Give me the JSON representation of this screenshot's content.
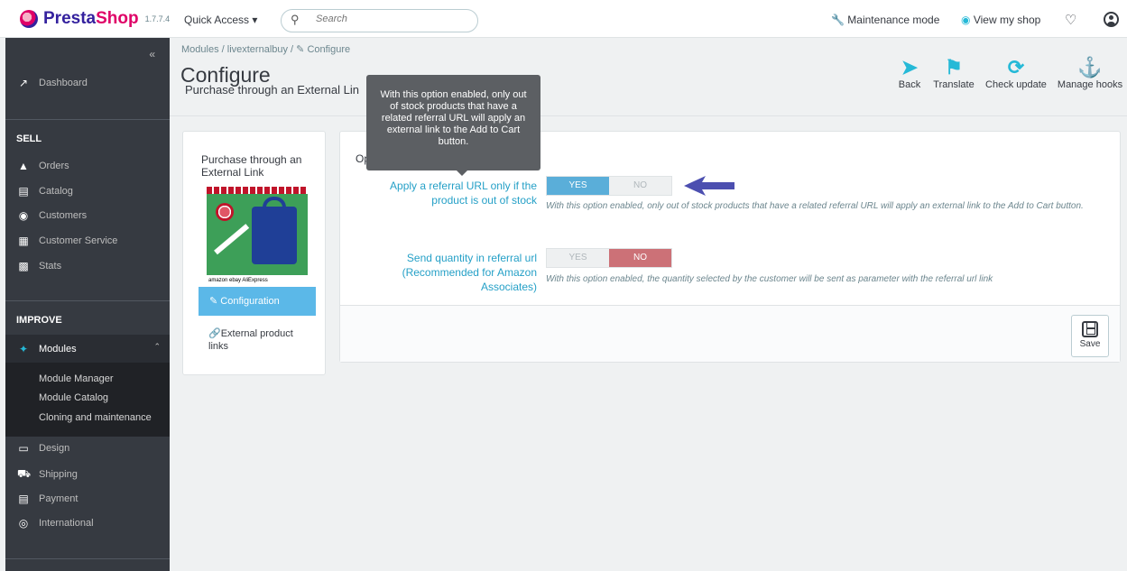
{
  "header": {
    "brand_name_a": "Presta",
    "brand_name_b": "Shop",
    "version": "1.7.7.4",
    "quick_access": "Quick Access ▾",
    "search_placeholder": "Search",
    "maintenance": "Maintenance mode",
    "view_shop": "View my shop"
  },
  "sidebar": {
    "dashboard": "Dashboard",
    "sell_title": "SELL",
    "sell_items": [
      "Orders",
      "Catalog",
      "Customers",
      "Customer Service",
      "Stats"
    ],
    "improve_title": "IMPROVE",
    "modules": "Modules",
    "module_sub": [
      "Module Manager",
      "Module Catalog",
      "Cloning and maintenance"
    ],
    "improve_items": [
      "Design",
      "Shipping",
      "Payment",
      "International"
    ]
  },
  "page": {
    "breadcrumb": "Modules  /  livexternalbuy  /  ✎ Configure",
    "title": "Configure",
    "subtitle": "Purchase through an External Lin"
  },
  "toolbar": {
    "back": "Back",
    "translate": "Translate",
    "check_update": "Check update",
    "manage_hooks": "Manage hooks"
  },
  "module_card": {
    "name": "Purchase through an External Link",
    "market_text": "amazon  ebay  AliExpress",
    "configuration": "Configuration",
    "external_links": "External product links"
  },
  "options": {
    "heading": "Op",
    "opt1_label": "Apply a referral URL only if the product is out of stock",
    "opt1_yes": "YES",
    "opt1_no": "NO",
    "opt1_help": "With this option enabled, only out of stock products that have a related referral URL will apply an external link to the Add to Cart button.",
    "opt2_label": "Send quantity in referral url (Recommended for Amazon Associates)",
    "opt2_yes": "YES",
    "opt2_no": "NO",
    "opt2_help": "With this option enabled, the quantity selected by the customer will be sent as parameter with the referral url link",
    "save": "Save"
  },
  "tooltip": {
    "text": "With this option enabled, only out of stock products that have a related referral URL will apply an external link to the Add to Cart button."
  },
  "colors": {
    "accent": "#25b9d7",
    "sidebar_bg": "#363a41",
    "yes_active": "#5aaed9",
    "no_active": "#cc7177",
    "annotation_arrow": "#4c4fb0"
  }
}
